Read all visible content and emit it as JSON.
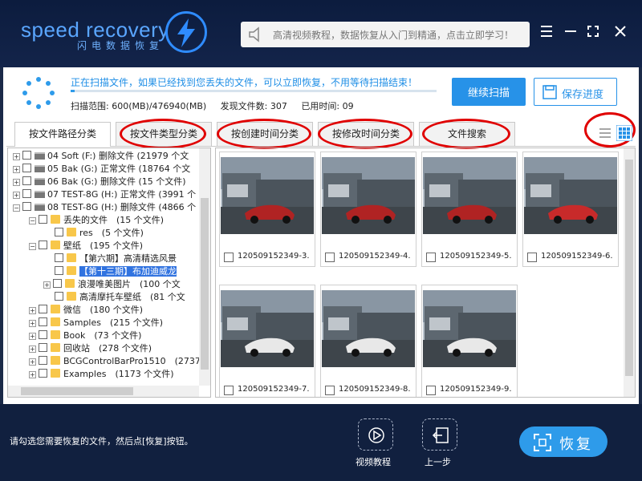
{
  "app": {
    "brand_en": "speed recovery",
    "brand_cn": "闪电数据恢复",
    "search_placeholder": "高清视频教程，数据恢复从入门到精通，点击立即学习！"
  },
  "scan": {
    "message": "正在扫描文件，如果已经找到您丢失的文件，可以立即恢复，不用等待扫描结束！",
    "range_label": "扫描范围:",
    "range_value": "600(MB)/476940(MB)",
    "found_label": "发现文件数:",
    "found_value": "307",
    "time_label": "已用时间:",
    "time_value": "09",
    "continue_label": "继续扫描",
    "save_label": "保存进度",
    "progress": 0.01
  },
  "tabs": [
    {
      "label": "按文件路径分类"
    },
    {
      "label": "按文件类型分类"
    },
    {
      "label": "按创建时间分类"
    },
    {
      "label": "按修改时间分类"
    },
    {
      "label": "文件搜索"
    }
  ],
  "tree": [
    {
      "text": "04 Soft (F:) 删除文件 (21979 个文"
    },
    {
      "text": "05 Bak (G:) 正常文件 (18764 个文"
    },
    {
      "text": "06 Bak (G:) 删除文件 (15 个文件)"
    },
    {
      "text": "07 TEST-8G (H:) 正常文件 (3991 个"
    },
    {
      "text": "08 TEST-8G (H:) 删除文件 (4866 个"
    },
    {
      "text": "丢失的文件　(15 个文件)"
    },
    {
      "text": "res　(5 个文件)"
    },
    {
      "text": "壁纸　(195 个文件)"
    },
    {
      "text": "【第六期】高清精选风景"
    },
    {
      "text": "【第十三期】布加迪威龙"
    },
    {
      "text": "浪漫唯美图片　(100 个文"
    },
    {
      "text": "高清摩托车壁纸　(81 个文"
    },
    {
      "text": "微信　(180 个文件)"
    },
    {
      "text": "Samples　(215 个文件)"
    },
    {
      "text": "Book　(73 个文件)"
    },
    {
      "text": "回收站　(278 个文件)"
    },
    {
      "text": "BCGControlBarPro1510　(2737"
    },
    {
      "text": "Examples　(1173 个文件)"
    }
  ],
  "files": [
    {
      "name": "120509152349-3."
    },
    {
      "name": "120509152349-4."
    },
    {
      "name": "120509152349-5."
    },
    {
      "name": "120509152349-6."
    },
    {
      "name": "120509152349-7."
    },
    {
      "name": "120509152349-8."
    },
    {
      "name": "120509152349-9."
    }
  ],
  "footer": {
    "hint": "请勾选您需要恢复的文件，然后点[恢复]按钮。",
    "video_label": "视频教程",
    "back_label": "上一步",
    "recover_label": "恢复"
  },
  "colors": {
    "accent": "#2792e8",
    "highlight_ring": "#e00000",
    "header_bg": "#0c1c3e"
  }
}
